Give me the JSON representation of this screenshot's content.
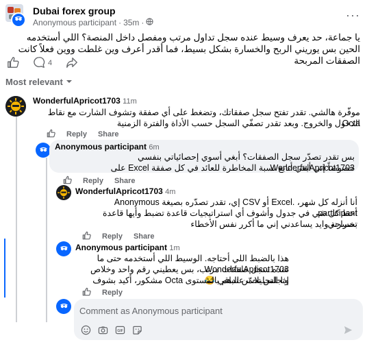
{
  "post": {
    "group_name": "Dubai forex group",
    "author": "Anonymous participant",
    "time": "35m",
    "body": "يا جماعة، حد يعرف وسيط عنده سجل تداول مرتب ومفصل داخل المنصة؟ اللي أستخدمه الحين بس يوريني الربح والخسارة بشكل بسيط، فما أقدر أعرف وين غلطت ووين فعلاً كانت الصفقات المربحة",
    "comment_count": "4"
  },
  "sort": {
    "label": "Most relevant"
  },
  "comments": [
    {
      "author": "WonderfulApricot1703",
      "time": "11m",
      "text_line1": "موفّرة هالشي. تقدر تفتح سجل صفقاتك، وتضغط على أي صفقة وتشوف الشارت مع نقاط Octa",
      "text_line2": "الدخول والخروج. وبعد تقدر تصفّي السجل حسب الأداة والفترة الزمنية",
      "reply": "Reply",
      "share": "Share"
    },
    {
      "author": "Anonymous participant",
      "time": "6m",
      "text_line1": "بس تقدر تصدّر سجل الصفقات؟ أبغي أسوي إحصائياتي بنفسي WonderfulApricot1703",
      "text_line2": "خصوصاً إني أبغي أتابع نسبة المخاطرة للعائد في كل صفقة Excel على",
      "reply": "Reply",
      "share": "Share"
    },
    {
      "author": "WonderfulApricot1703",
      "time": "4m",
      "text_line1": "أنا أنزله كل شهر، .Excel أو CSV إي، تقدر تصدّره بصيغة Anonymous participant",
      "text_line2": "أحط كل شي في جدول وأشوف أي استراتيجيات قاعدة تضبط وأيها قاعدة تخسرني.",
      "text_line3": "بصراحة وايد يساعدني إني ما أكرر نفس الأخطاء",
      "reply": "Reply",
      "share": "Share"
    },
    {
      "author": "Anonymous participant",
      "time": "1m",
      "text_line1": "هذا بالضبط اللي أحتاجه. الوسيط اللي أستخدمه حتى ما WonderfulApricot1703",
      "text_line2": "عنده سجل صفقات مرتب، بس يعطيني رقم واحد وخلاص وتجلس تخمّن الباقي 😂",
      "text_line3": "إذا التحليلات عندهم بالمستوى Octa مشكور، أكيد بشوف",
      "reply": "Reply"
    }
  ],
  "composer": {
    "placeholder": "Comment as Anonymous participant"
  },
  "icons": {
    "globe": "globe-icon",
    "like": "like-icon",
    "comment": "comment-icon",
    "share": "share-icon",
    "more": "more-icon",
    "emoji": "emoji-icon",
    "camera": "camera-icon",
    "gif": "gif-icon",
    "sticker": "sticker-icon",
    "send": "send-icon"
  },
  "colors": {
    "accent": "#0866ff",
    "muted": "#65676b",
    "bubble": "#f0f2f5"
  }
}
